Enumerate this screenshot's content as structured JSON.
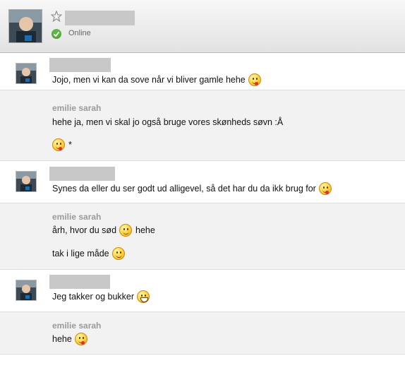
{
  "header": {
    "status": "Online"
  },
  "messages": {
    "m1": {
      "text": "Jojo, men vi kan da sove når vi bliver gamle hehe",
      "emoticon": "tongue-smiley-icon"
    },
    "t1": {
      "sender": "emilie sarah",
      "line1": "hehe ja, men vi skal jo også bruge vores skønheds søvn :Å",
      "line2": "*",
      "emoticon": "tongue-smiley-icon"
    },
    "m2": {
      "text": "Synes da eller du ser godt ud alligevel, så det har du da ikk brug for",
      "emoticon": "tongue-smiley-icon"
    },
    "t2": {
      "sender": "emilie sarah",
      "line1a": "årh, hvor du sød",
      "line1b": "hehe",
      "line2": "tak i lige måde",
      "emoticon": "smiley-icon"
    },
    "m3": {
      "text": "Jeg takker og bukker",
      "emoticon": "grin-smiley-icon"
    },
    "t3": {
      "sender": "emilie sarah",
      "text": "hehe",
      "emoticon": "tongue-smiley-icon"
    }
  }
}
